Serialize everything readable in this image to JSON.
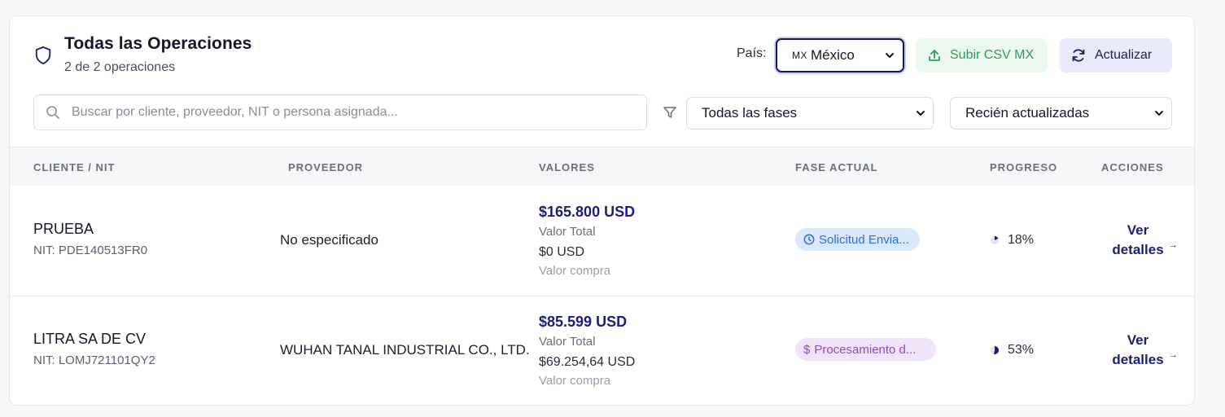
{
  "header": {
    "title": "Todas las Operaciones",
    "subtitle": "2 de 2 operaciones",
    "country_label": "País:",
    "country_flag": "MX",
    "country_value": "México",
    "upload_button": "Subir CSV MX",
    "refresh_button": "Actualizar"
  },
  "filters": {
    "search_placeholder": "Buscar por cliente, proveedor, NIT o persona asignada...",
    "search_value": "",
    "phase_value": "Todas las fases",
    "sort_value": "Recién actualizadas"
  },
  "table": {
    "columns": [
      "CLIENTE / NIT",
      "PROVEEDOR",
      "VALORES",
      "FASE ACTUAL",
      "PROGRESO",
      "ACCIONES"
    ],
    "rows": [
      {
        "client": "PRUEBA",
        "nit": "NIT: PDE140513FR0",
        "provider": "No especificado",
        "total_value": "$165.800 USD",
        "total_label": "Valor Total",
        "purchase_value": "$0 USD",
        "purchase_label": "Valor compra",
        "phase": "Solicitud Envia...",
        "progress": "18%",
        "progress_fraction": 0.18,
        "action": "Ver detalles"
      },
      {
        "client": "LITRA SA DE CV",
        "nit": "NIT: LOMJ721101QY2",
        "provider": "WUHAN TANAL INDUSTRIAL CO., LTD.",
        "total_value": "$85.599 USD",
        "total_label": "Valor Total",
        "purchase_value": "$69.254,64 USD",
        "purchase_label": "Valor compra",
        "phase": "Procesamiento d...",
        "progress": "53%",
        "progress_fraction": 0.53,
        "action": "Ver detalles"
      }
    ]
  },
  "colors": {
    "primary": "#1b2076",
    "success": "#2f9a55",
    "phase_blue": "#2c6be0",
    "phase_purple": "#9b3fd0"
  }
}
